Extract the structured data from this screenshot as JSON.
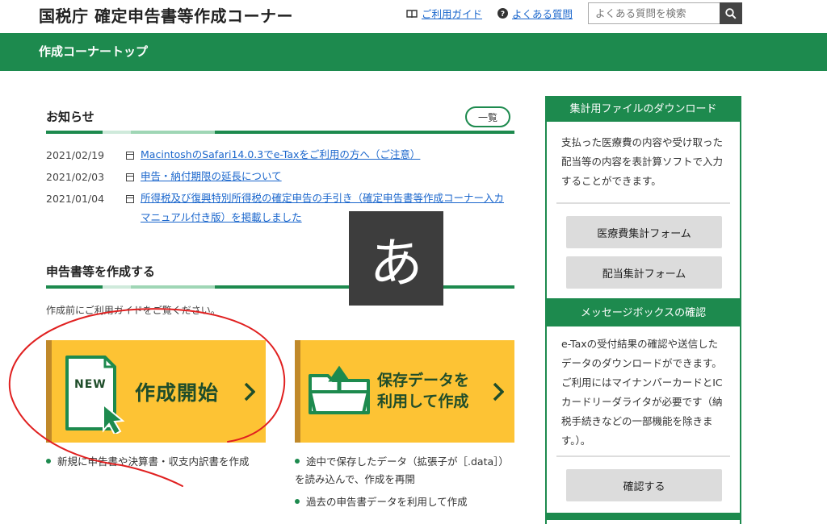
{
  "header": {
    "title": "国税庁 確定申告書等作成コーナー",
    "guide_link": "ご利用ガイド",
    "faq_link": "よくある質問",
    "search_placeholder": "よくある質問を検索"
  },
  "nav": {
    "title": "作成コーナートップ"
  },
  "news": {
    "heading": "お知らせ",
    "list_button": "一覧",
    "items": [
      {
        "date": "2021/02/19",
        "text": "MacintoshのSafari14.0.3でe-Taxをご利用の方へ（ご注意）"
      },
      {
        "date": "2021/02/03",
        "text": "申告・納付期限の延長について"
      },
      {
        "date": "2021/01/04",
        "text": "所得税及び復興特別所得税の確定申告の手引き（確定申告書等作成コーナー入カマニュアル付き版）を掲載しました"
      }
    ]
  },
  "create": {
    "heading": "申告書等を作成する",
    "note": "作成前にご利用ガイドをご覧ください。",
    "start_card": {
      "badge": "NEW",
      "label": "作成開始",
      "bullets": [
        "新規に申告書や決算書・収支内訳書を作成"
      ]
    },
    "saved_card": {
      "label_line1": "保存データを",
      "label_line2": "利用して作成",
      "bullets": [
        "途中で保存したデータ（拡張子が［.data］）を読み込んで、作成を再開",
        "過去の申告書データを利用して作成"
      ]
    }
  },
  "sidebar": {
    "download": {
      "heading": "集計用ファイルのダウンロード",
      "text": "支払った医療費の内容や受け取った配当等の内容を表計算ソフトで入力することができます。",
      "buttons": [
        "医療費集計フォーム",
        "配当集計フォーム"
      ]
    },
    "message_box": {
      "heading": "メッセージボックスの確認",
      "text": "e-Taxの受付結果の確認や送信したデータのダウンロードができます。ご利用にはマイナンバーカードとICカードリーダライタが必要です（納税手続きなどの一部機能を除きます。）。",
      "button": "確認する"
    }
  },
  "ime_indicator": "あ",
  "colors": {
    "brand_green": "#1d8a4e",
    "card_yellow": "#fdc334",
    "link_blue": "#1a66cc",
    "annotation_red": "#e02020"
  }
}
